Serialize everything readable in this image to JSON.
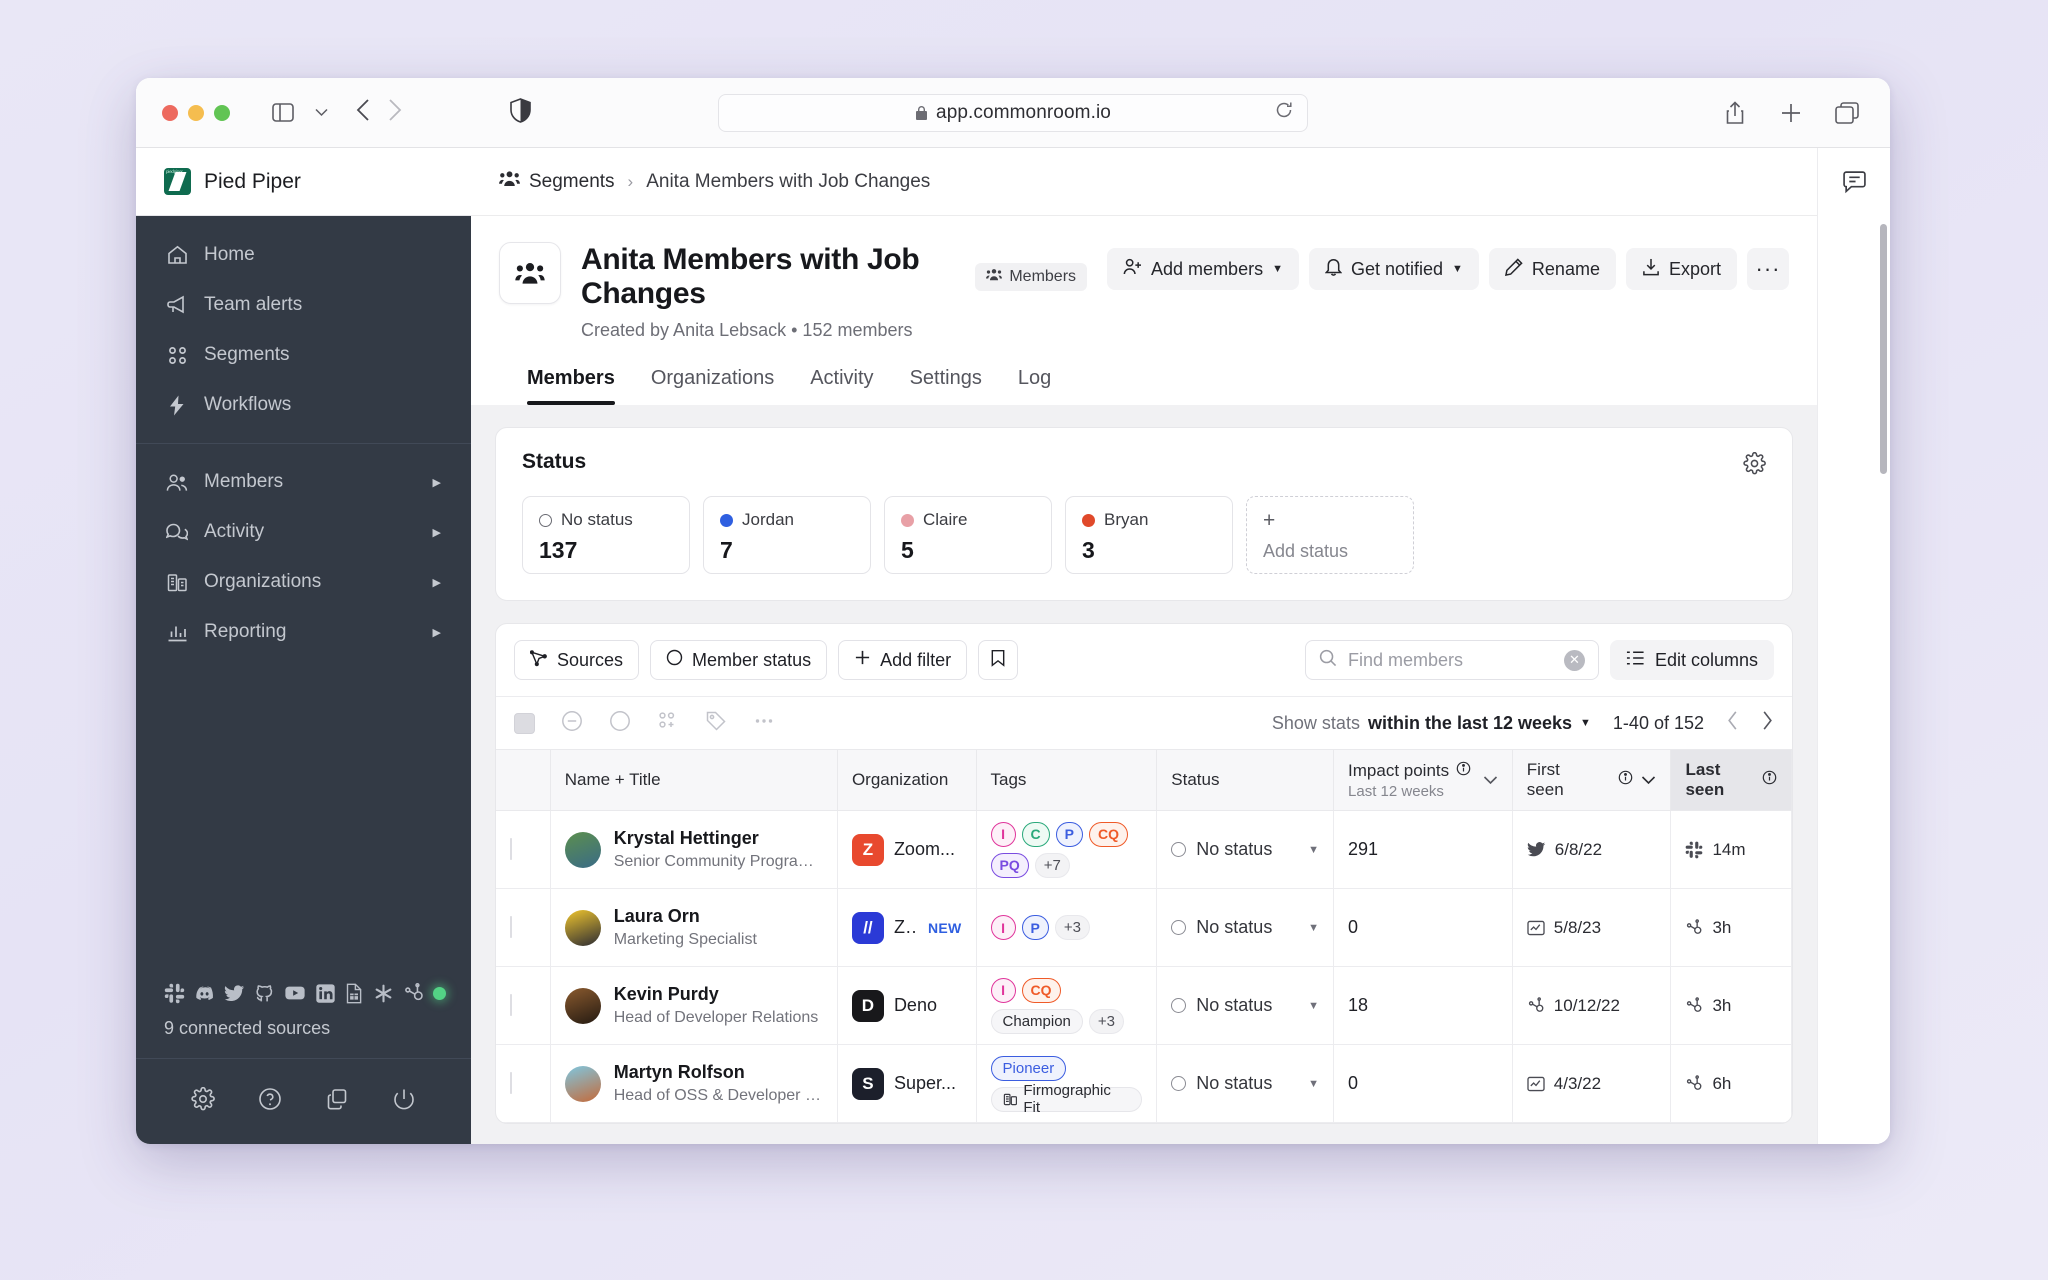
{
  "browser": {
    "url": "app.commonroom.io",
    "lock_icon": "lock-icon",
    "reload_icon": "reload-icon",
    "sidebar_toggle_icon": "sidebar-toggle-icon",
    "chevron_down_icon": "chevron-down-icon",
    "back_icon": "back-arrow-icon",
    "forward_icon": "forward-arrow-icon",
    "shield_icon": "shield-icon",
    "share_icon": "share-icon",
    "new_tab_icon": "plus-icon",
    "tabs_icon": "tab-overview-icon"
  },
  "workspace": {
    "name": "Pied Piper",
    "logo_text": "piedpiper"
  },
  "sidebar": {
    "items": [
      {
        "label": "Home",
        "icon": "home-icon",
        "expandable": false
      },
      {
        "label": "Team alerts",
        "icon": "megaphone-icon",
        "expandable": false
      },
      {
        "label": "Segments",
        "icon": "segments-icon",
        "expandable": false
      },
      {
        "label": "Workflows",
        "icon": "lightning-icon",
        "expandable": false
      },
      {
        "label": "Members",
        "icon": "members-icon",
        "expandable": true
      },
      {
        "label": "Activity",
        "icon": "activity-chat-icon",
        "expandable": true
      },
      {
        "label": "Organizations",
        "icon": "organizations-icon",
        "expandable": true
      },
      {
        "label": "Reporting",
        "icon": "reporting-icon",
        "expandable": true
      }
    ],
    "sources_label": "9 connected sources",
    "source_icons": [
      "slack-icon",
      "discord-icon",
      "twitter-icon",
      "github-icon",
      "youtube-icon",
      "linkedin-icon",
      "google-sheets-icon",
      "asterisk-icon",
      "hubspot-icon"
    ],
    "footer_icons": [
      "gear-icon",
      "help-icon",
      "copy-icon",
      "power-icon"
    ]
  },
  "breadcrumb": {
    "root": "Segments",
    "root_icon": "segments-group-icon",
    "separator": "›",
    "current": "Anita Members with Job Changes"
  },
  "page": {
    "avatar_icon": "group-avatar-icon",
    "title": "Anita Members with Job Changes",
    "badge": {
      "label": "Members",
      "icon": "members-badge-icon"
    },
    "subtitle": "Created by Anita Lebsack  •  152 members",
    "actions": [
      {
        "label": "Add members",
        "icon": "add-member-icon",
        "caret": true
      },
      {
        "label": "Get notified",
        "icon": "bell-icon",
        "caret": true
      },
      {
        "label": "Rename",
        "icon": "pencil-icon",
        "caret": false
      },
      {
        "label": "Export",
        "icon": "download-icon",
        "caret": false
      },
      {
        "label": "···",
        "icon": "more-icon",
        "caret": false
      }
    ],
    "tabs": [
      {
        "label": "Members",
        "active": true
      },
      {
        "label": "Organizations",
        "active": false
      },
      {
        "label": "Activity",
        "active": false
      },
      {
        "label": "Settings",
        "active": false
      },
      {
        "label": "Log",
        "active": false
      }
    ]
  },
  "status_panel": {
    "title": "Status",
    "gear_icon": "gear-icon",
    "tiles": [
      {
        "label": "No status",
        "count": "137",
        "color": "",
        "ring": true
      },
      {
        "label": "Jordan",
        "count": "7",
        "color": "#2f5fe0",
        "ring": false
      },
      {
        "label": "Claire",
        "count": "5",
        "color": "#e8a0a6",
        "ring": false
      },
      {
        "label": "Bryan",
        "count": "3",
        "color": "#e0492a",
        "ring": false
      }
    ],
    "add_tile": {
      "plus": "+",
      "label": "Add status"
    }
  },
  "filters": {
    "buttons": [
      {
        "label": "Sources",
        "icon": "sources-icon"
      },
      {
        "label": "Member status",
        "icon": "circle-icon"
      },
      {
        "label": "Add filter",
        "icon": "plus-icon"
      }
    ],
    "bookmark_icon": "bookmark-icon",
    "search": {
      "placeholder": "Find members",
      "value": "",
      "icon": "search-icon",
      "clear_icon": "clear-x-icon"
    },
    "edit_columns": {
      "label": "Edit columns",
      "icon": "columns-icon"
    }
  },
  "toolbar": {
    "icons": [
      "select-all-checkbox",
      "minus-circle-icon",
      "circle-icon",
      "add-to-segment-icon",
      "tag-icon",
      "more-icon"
    ],
    "show_stats_prefix": "Show stats",
    "show_stats_value": "within the last 12 weeks",
    "range": "1-40 of 152",
    "prev_icon": "chevron-left-icon",
    "next_icon": "chevron-right-icon"
  },
  "table": {
    "columns": [
      {
        "key": "checkbox",
        "label": ""
      },
      {
        "key": "name",
        "label": "Name + Title"
      },
      {
        "key": "organization",
        "label": "Organization"
      },
      {
        "key": "tags",
        "label": "Tags"
      },
      {
        "key": "status",
        "label": "Status"
      },
      {
        "key": "impact",
        "label": "Impact points",
        "sublabel": "Last 12 weeks",
        "info": true,
        "chevron": true
      },
      {
        "key": "first_seen",
        "label": "First seen",
        "info": true,
        "chevron": true
      },
      {
        "key": "last_seen",
        "label": "Last seen",
        "info": true,
        "highlight": true
      }
    ],
    "rows": [
      {
        "name": "Krystal Hettinger",
        "title": "Senior Community Program...",
        "avatar_colors": [
          "#5c8f4e",
          "#3a6b86"
        ],
        "organization": "Zoom...",
        "org_logo_text": "Z",
        "org_logo_bg": "#e8492e",
        "org_new": false,
        "tags": [
          {
            "text": "I",
            "color": "#e0359b",
            "bg": "#fdf0f8"
          },
          {
            "text": "C",
            "color": "#2aa97b",
            "bg": "#eefaf4"
          },
          {
            "text": "P",
            "color": "#3b5de0",
            "bg": "#eff2fd"
          },
          {
            "text": "CQ",
            "color": "#ef5a28",
            "bg": "#fef2ec"
          },
          {
            "text": "PQ",
            "color": "#7a4ce0",
            "bg": "#f4effd"
          },
          {
            "text": "+7",
            "plus": true
          }
        ],
        "status": "No status",
        "impact": "291",
        "first_seen": {
          "value": "6/8/22",
          "icon": "twitter-icon"
        },
        "last_seen": {
          "value": "14m",
          "icon": "slack-icon"
        }
      },
      {
        "name": "Laura Orn",
        "title": "Marketing Specialist",
        "avatar_colors": [
          "#efc52e",
          "#2b2b33"
        ],
        "organization": "Z...",
        "org_logo_text": "//",
        "org_logo_bg": "#2b3ad6",
        "org_new": true,
        "org_new_label": "NEW",
        "tags": [
          {
            "text": "I",
            "color": "#e0359b",
            "bg": "#fdf0f8"
          },
          {
            "text": "P",
            "color": "#3b5de0",
            "bg": "#eff2fd"
          },
          {
            "text": "+3",
            "plus": true
          }
        ],
        "status": "No status",
        "impact": "0",
        "first_seen": {
          "value": "5/8/23",
          "icon": "activity-chart-icon"
        },
        "last_seen": {
          "value": "3h",
          "icon": "hubspot-icon"
        }
      },
      {
        "name": "Kevin Purdy",
        "title": "Head of Developer Relations",
        "avatar_colors": [
          "#8a5a2e",
          "#241a12"
        ],
        "organization": "Deno",
        "org_logo_text": "D",
        "org_logo_bg": "#18181b",
        "org_new": false,
        "tags": [
          {
            "text": "I",
            "color": "#e0359b",
            "bg": "#fdf0f8"
          },
          {
            "text": "CQ",
            "color": "#ef5a28",
            "bg": "#fef2ec"
          },
          {
            "text": "Champion",
            "grey": true,
            "wide": true
          },
          {
            "text": "+3",
            "plus": true
          }
        ],
        "status": "No status",
        "impact": "18",
        "first_seen": {
          "value": "10/12/22",
          "icon": "hubspot-icon"
        },
        "last_seen": {
          "value": "3h",
          "icon": "hubspot-icon"
        }
      },
      {
        "name": "Martyn Rolfson",
        "title": "Head of OSS & Developer R...",
        "avatar_colors": [
          "#7fc7e0",
          "#c46a3a"
        ],
        "organization": "Super...",
        "org_logo_text": "S",
        "org_logo_bg": "#1c1f2b",
        "org_new": false,
        "tags": [
          {
            "text": "Pioneer",
            "color": "#3b5de0",
            "bg": "#eff2fd",
            "wide": true
          },
          {
            "text": "Firmographic Fit",
            "grey": true,
            "wide": true,
            "icon": "firmographic-icon"
          }
        ],
        "status": "No status",
        "impact": "0",
        "first_seen": {
          "value": "4/3/22",
          "icon": "activity-chart-icon"
        },
        "last_seen": {
          "value": "6h",
          "icon": "hubspot-icon"
        }
      }
    ],
    "status_caret_icon": "caret-down-icon",
    "status_ring_icon": "circle-icon"
  },
  "right_rail": {
    "comment_icon": "comment-icon"
  }
}
